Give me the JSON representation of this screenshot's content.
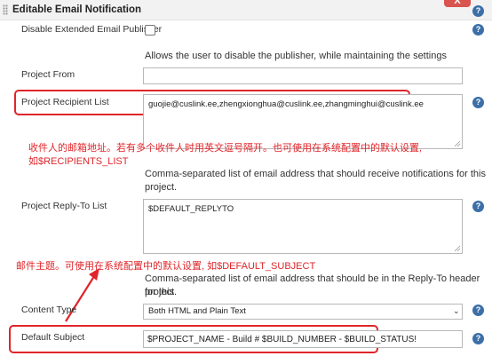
{
  "section": {
    "title": "Editable Email Notification",
    "close_label": "X"
  },
  "disable_publisher": {
    "label": "Disable Extended Email Publisher",
    "description": "Allows the user to disable the publisher, while maintaining the settings",
    "checked": false
  },
  "project_from": {
    "label": "Project From",
    "value": ""
  },
  "recipient_list": {
    "label": "Project Recipient List",
    "value": "guojie@cuslink.ee,zhengxionghua@cuslink.ee,zhangminghui@cuslink.ee",
    "annotation_line1": "收件人的邮箱地址。若有多个收件人时用英文逗号隔开。也可使用在系统配置中的默认设置,",
    "annotation_line2": "如$RECIPIENTS_LIST",
    "description_line1": "Comma-separated list of email address that should receive notifications for this",
    "description_line2": "project."
  },
  "reply_to": {
    "label": "Project Reply-To List",
    "value": "$DEFAULT_REPLYTO",
    "annotation": "邮件主题。可使用在系统配置中的默认设置, 如$DEFAULT_SUBJECT",
    "description_line1": "Comma-separated list of email address that should be in the Reply-To header for this",
    "description_line2": "project."
  },
  "content_type": {
    "label": "Content Type",
    "selected": "Both HTML and Plain Text"
  },
  "default_subject": {
    "label": "Default Subject",
    "value": "$PROJECT_NAME - Build # $BUILD_NUMBER - $BUILD_STATUS!"
  },
  "help_icon_text": "?",
  "colors": {
    "annotation_red": "#e0252a",
    "help_blue": "#3c6fa8",
    "close_red": "#d9534f"
  }
}
